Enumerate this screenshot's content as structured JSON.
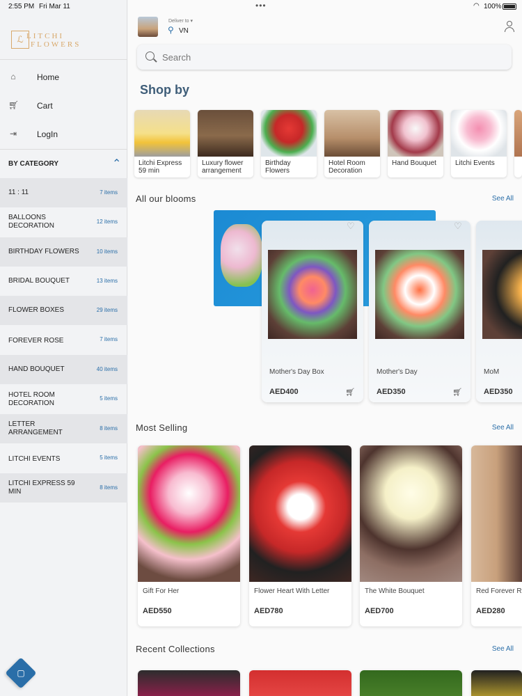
{
  "status_bar": {
    "time": "2:55 PM",
    "date": "Fri Mar 11",
    "battery": "100%"
  },
  "brand": {
    "logo_line1": "LITCHI",
    "logo_line2": "FLOWERS"
  },
  "sidebar": {
    "nav": [
      {
        "label": "Home",
        "icon": "home-icon"
      },
      {
        "label": "Cart",
        "icon": "cart-icon"
      },
      {
        "label": "LogIn",
        "icon": "login-icon"
      }
    ],
    "category_header": "BY CATEGORY",
    "categories": [
      {
        "name": "11 : 11",
        "count": "7 items"
      },
      {
        "name": "BALLOONS DECORATION",
        "count": "12 items"
      },
      {
        "name": "BIRTHDAY FLOWERS",
        "count": "10 items"
      },
      {
        "name": "BRIDAL BOUQUET",
        "count": "13 items"
      },
      {
        "name": "FLOWER BOXES",
        "count": "29 items"
      },
      {
        "name": "FOREVER ROSE",
        "count": "7 items"
      },
      {
        "name": "HAND BOUQUET",
        "count": "40 items"
      },
      {
        "name": "HOTEL ROOM DECORATION",
        "count": "5 items"
      },
      {
        "name": "LETTER ARRANGEMENT",
        "count": "8 items"
      },
      {
        "name": "LITCHI EVENTS",
        "count": "5 items"
      },
      {
        "name": "LITCHI EXPRESS 59 MIN",
        "count": "8 items"
      }
    ]
  },
  "header": {
    "deliver_to": "Deliver to",
    "location": "VN"
  },
  "search": {
    "placeholder": "Search"
  },
  "shop_by": {
    "title": "Shop by",
    "items": [
      {
        "label": "Litchi Express 59 min"
      },
      {
        "label": "Luxury flower arrangement"
      },
      {
        "label": "Birthday Flowers"
      },
      {
        "label": "Hotel Room Decoration"
      },
      {
        "label": "Hand Bouquet"
      },
      {
        "label": "Litchi Events"
      }
    ]
  },
  "blooms": {
    "title": "All our blooms",
    "see_all": "See All",
    "items": [
      {
        "name": "Mother's Day Box",
        "price": "AED400"
      },
      {
        "name": "Mother's Day",
        "price": "AED350"
      },
      {
        "name": "MoM",
        "price": "AED350"
      }
    ]
  },
  "most_selling": {
    "title": "Most Selling",
    "see_all": "See All",
    "items": [
      {
        "name": "Gift For Her",
        "price": "AED550"
      },
      {
        "name": "Flower Heart With Letter",
        "price": "AED780"
      },
      {
        "name": "The White Bouquet",
        "price": "AED700"
      },
      {
        "name": "Red Forever Ro",
        "price": "AED280"
      }
    ]
  },
  "recent": {
    "title": "Recent Collections",
    "see_all": "See All"
  },
  "colors": {
    "accent": "#2a6ea8",
    "heading": "#3e5d78",
    "brand_gold": "#d8a86a"
  }
}
